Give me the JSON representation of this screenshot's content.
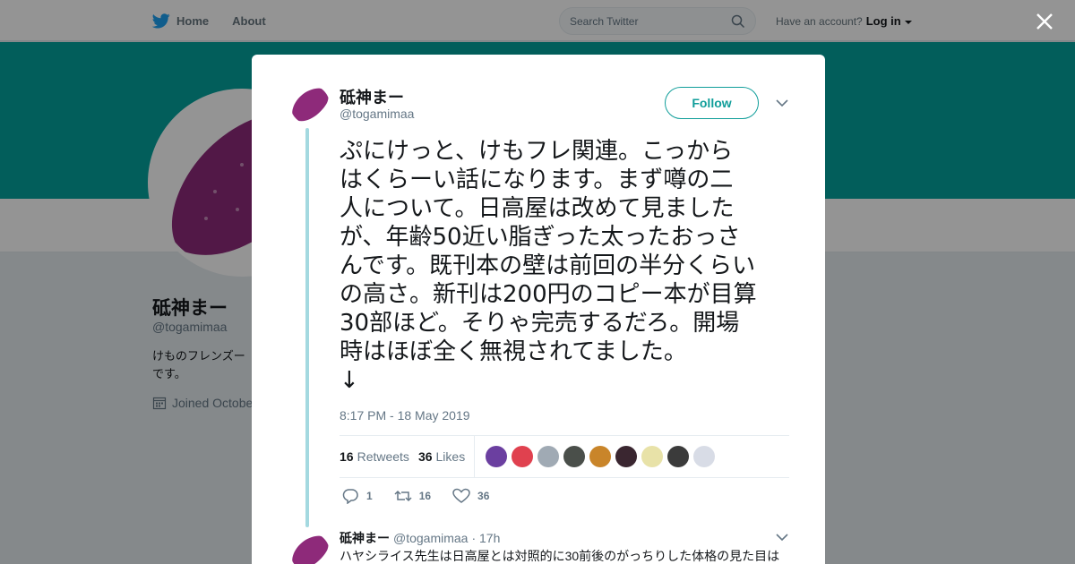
{
  "header": {
    "home_label": "Home",
    "about_label": "About",
    "search_placeholder": "Search Twitter",
    "account_prompt": "Have an account?",
    "login_label": "Log in"
  },
  "profile": {
    "name": "砥神まー",
    "handle": "@togamimaa",
    "bio": "けものフレンズー\nです。",
    "joined": "Joined Octobe"
  },
  "tweet": {
    "author_name": "砥神まー",
    "author_handle": "@togamimaa",
    "follow_label": "Follow",
    "text": "ぷにけっと、けもフレ関連。こっから\nはくらーい話になります。まず噂の二\n人について。日高屋は改めて見ました\nが、年齢50近い脂ぎった太ったおっさ\nんです。既刊本の壁は前回の半分くらい\nの高さ。新刊は200円のコピー本が目算\n30部ほど。そりゃ完売するだろ。開場\n時はほぼ全く無視されてました。\n↓",
    "timestamp": "8:17 PM - 18 May 2019",
    "retweets_count": "16",
    "retweets_label": "Retweets",
    "likes_count": "36",
    "likes_label": "Likes",
    "likers": [
      "#6b3fa0",
      "#e0414f",
      "#a0aab4",
      "#4a4f4a",
      "#c9852a",
      "#3a2630",
      "#e8e2a8",
      "#3b3b3b",
      "#d8dce6"
    ],
    "actions": {
      "reply_count": "1",
      "retweet_count": "16",
      "like_count": "36"
    }
  },
  "reply": {
    "author_name": "砥神まー",
    "author_handle": "@togamimaa",
    "age": "· 17h",
    "text": "ハヤシライス先生は日高屋とは対照的に30前後のがっちりした体格の見た目は"
  },
  "colors": {
    "accent": "#109e9a",
    "banner": "#05a39e",
    "avatar_purple": "#8e2a7a"
  }
}
